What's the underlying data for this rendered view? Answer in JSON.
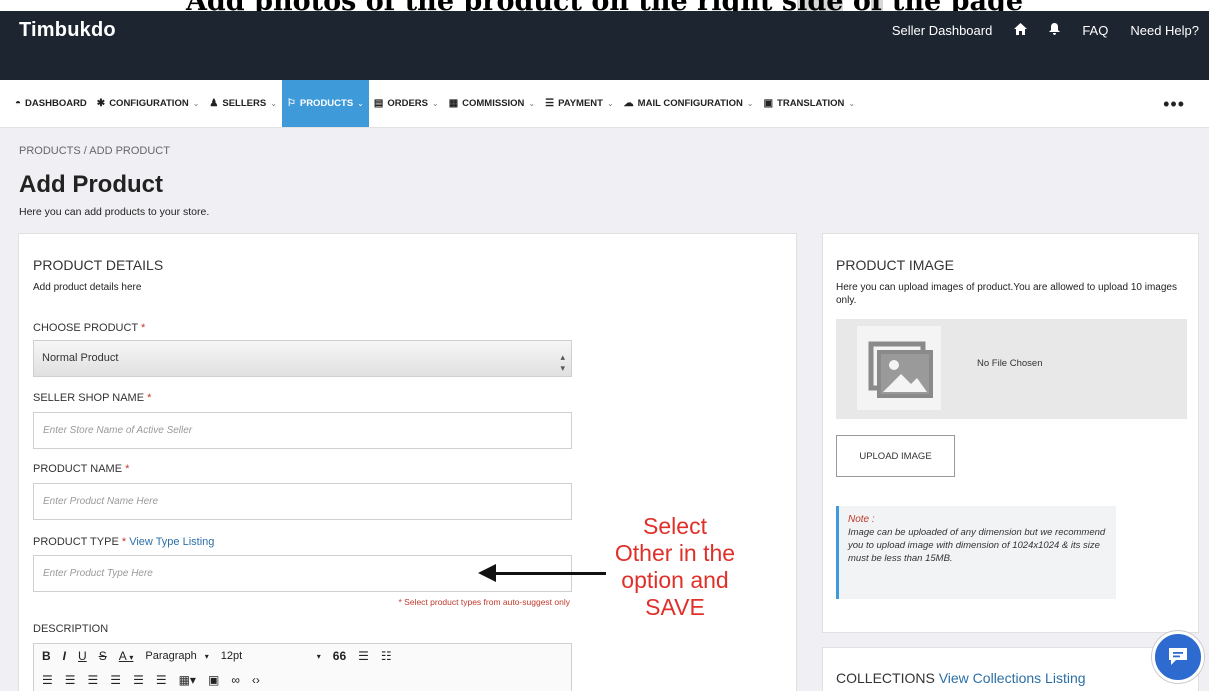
{
  "overlay": {
    "caption_pre": "Add photos of the product on the right s",
    "caption_hl": "ide",
    "caption_mid": " o",
    "caption_hl2": "f",
    "caption_post": " the page"
  },
  "header": {
    "brand": "Timbukdo",
    "seller_dashboard": "Seller Dashboard",
    "faq": "FAQ",
    "need_help": "Need Help?"
  },
  "nav": {
    "items": [
      {
        "label": "Dashboard",
        "icon": "dashboard-icon"
      },
      {
        "label": "Configuration",
        "icon": "gear-icon"
      },
      {
        "label": "Sellers",
        "icon": "users-icon"
      },
      {
        "label": "Products",
        "icon": "tag-icon"
      },
      {
        "label": "Orders",
        "icon": "orders-icon"
      },
      {
        "label": "Commission",
        "icon": "commission-icon"
      },
      {
        "label": "Payment",
        "icon": "payment-icon"
      },
      {
        "label": "Mail Configuration",
        "icon": "mail-icon"
      },
      {
        "label": "Translation",
        "icon": "translation-icon"
      }
    ],
    "more": "•••"
  },
  "page": {
    "breadcrumb": "PRODUCTS / ADD PRODUCT",
    "title": "Add Product",
    "subtitle": "Here you can add products to your store."
  },
  "details": {
    "title": "PRODUCT DETAILS",
    "subtitle": "Add product details here",
    "choose_label": "CHOOSE PRODUCT",
    "req": "*",
    "choose_value": "Normal Product",
    "shop_label": "SELLER SHOP NAME",
    "shop_placeholder": "Enter Store Name of Active Seller",
    "name_label": "PRODUCT NAME",
    "name_placeholder": "Enter Product Name Here",
    "type_label": "PRODUCT TYPE",
    "type_link": "View Type Listing",
    "type_placeholder": "Enter Product Type Here",
    "type_hint": "* Select product types from auto-suggest only",
    "desc_label": "DESCRIPTION",
    "toolbar": {
      "bold": "B",
      "italic": "I",
      "underline": "U",
      "strike": "S",
      "color": "A",
      "paragraph": "Paragraph",
      "size": "12pt",
      "quote": "66"
    }
  },
  "image": {
    "title": "PRODUCT IMAGE",
    "subtitle": "Here you can upload images of product.You are allowed to upload 10 images only.",
    "no_file": "No File Chosen",
    "upload": "UPLOAD IMAGE",
    "note_title": "Note :",
    "note_body": "Image can be uploaded of any dimension but we recommend you to upload image with dimension of 1024x1024 & its size must be less than 15MB."
  },
  "collections": {
    "title": "COLLECTIONS",
    "link": "View Collections Listing"
  },
  "annotation": {
    "line1": "Select",
    "line2": "Other in the",
    "line3": "option and",
    "line4": "SAVE"
  }
}
